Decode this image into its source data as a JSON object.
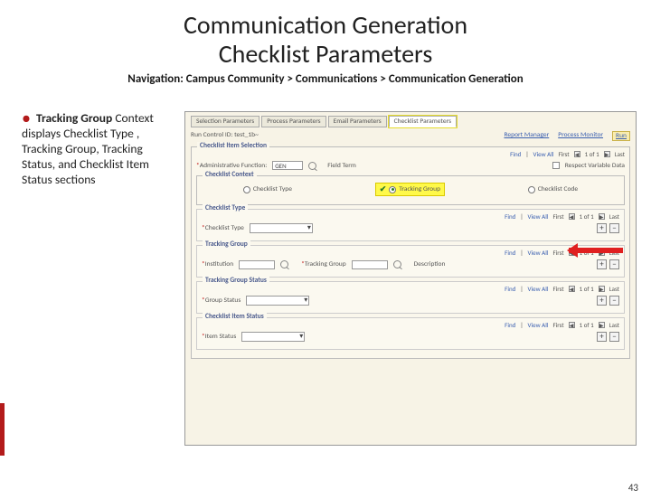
{
  "title_line1": "Communication Generation",
  "title_line2": "Checklist Parameters",
  "nav": "Navigation: Campus Community > Communications > Communication Generation",
  "bullet": {
    "lead": "Tracking Group",
    "rest": " Context displays Checklist Type , Tracking Group, Tracking Status, and Checklist Item Status sections"
  },
  "tabs": [
    "Selection Parameters",
    "Process Parameters",
    "Email Parameters",
    "Checklist Parameters"
  ],
  "run_control": {
    "label": "Run Control ID:",
    "value": "test_1b~"
  },
  "top_links": {
    "report": "Report Manager",
    "monitor": "Process Monitor",
    "run": "Run"
  },
  "group_main_title": "Checklist Item Selection",
  "findbar": {
    "find": "Find",
    "viewall": "View All",
    "first": "First",
    "count": "1 of 1",
    "last": "Last"
  },
  "admin_func": {
    "label": "Administrative Function:",
    "value": "GEN"
  },
  "field_term": "Field Term",
  "respect_var": "Respect Variable Data",
  "context_title": "Checklist Context",
  "context_opts": {
    "type": "Checklist Type",
    "group": "Tracking Group",
    "code": "Checklist Code"
  },
  "sub_type": {
    "title": "Checklist Type",
    "label": "Checklist Type"
  },
  "sub_group": {
    "title": "Tracking Group",
    "inst": "Institution",
    "tg": "Tracking Group",
    "desc": "Description"
  },
  "sub_status": {
    "title": "Tracking Group Status",
    "label": "Group Status"
  },
  "sub_item": {
    "title": "Checklist Item Status",
    "label": "Item Status"
  },
  "page_number": "43"
}
